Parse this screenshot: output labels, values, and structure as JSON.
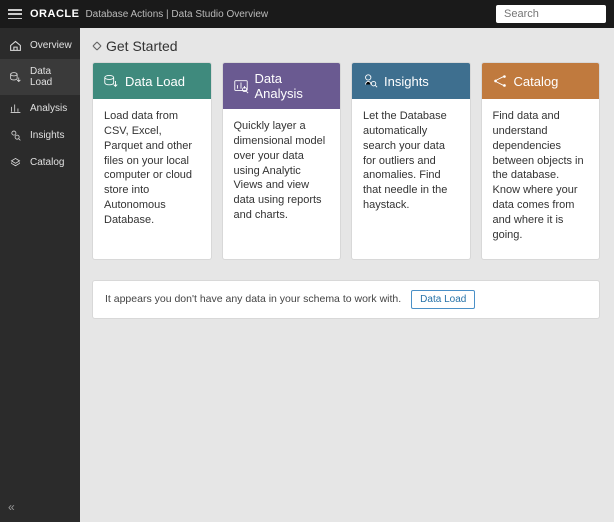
{
  "header": {
    "brand": "ORACLE",
    "breadcrumb": "Database Actions | Data Studio Overview",
    "search_placeholder": "Search"
  },
  "sidebar": {
    "items": [
      {
        "label": "Overview"
      },
      {
        "label": "Data Load"
      },
      {
        "label": "Analysis"
      },
      {
        "label": "Insights"
      },
      {
        "label": "Catalog"
      }
    ]
  },
  "main": {
    "page_title": "Get Started",
    "cards": [
      {
        "title": "Data Load",
        "body": "Load data from CSV, Excel, Parquet and other files on your local computer or cloud store into Autonomous Database."
      },
      {
        "title": "Data Analysis",
        "body": "Quickly layer a dimensional model over your data using Analytic Views and view data using reports and charts."
      },
      {
        "title": "Insights",
        "body": "Let the Database automatically search your data for outliers and anomalies. Find that needle in the haystack."
      },
      {
        "title": "Catalog",
        "body": "Find data and understand dependencies between objects in the database. Know where your data comes from and where it is going."
      }
    ],
    "notice": {
      "text": "It appears you don't have any data in your schema to work with.",
      "button": "Data Load"
    }
  }
}
